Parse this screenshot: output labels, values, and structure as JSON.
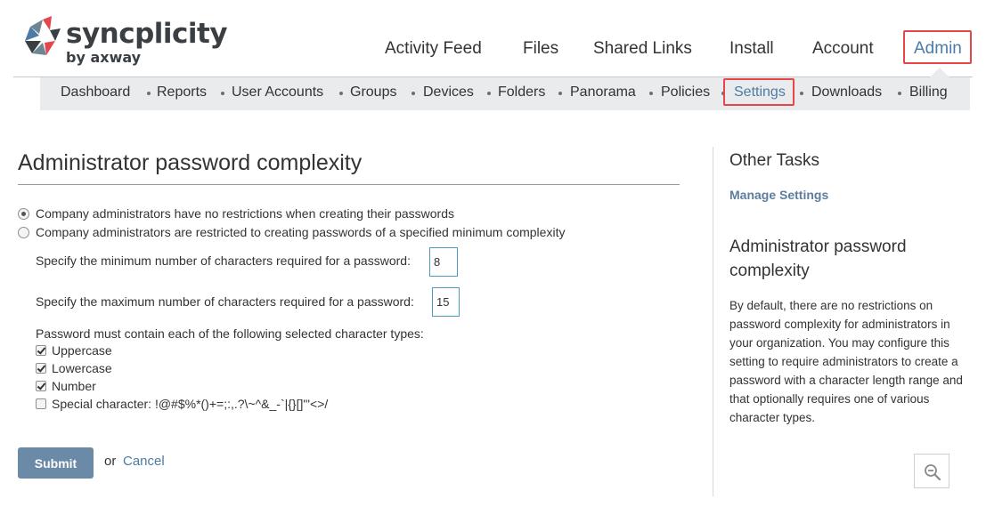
{
  "brand": {
    "name": "syncplicity",
    "sub": "by axway",
    "colors": [
      "#e4464a",
      "#4c7ba6",
      "#6e8596",
      "#3a3f44"
    ]
  },
  "main_nav": {
    "items": [
      {
        "label": "Activity Feed"
      },
      {
        "label": "Files"
      },
      {
        "label": "Shared Links"
      },
      {
        "label": "Install"
      },
      {
        "label": "Account"
      },
      {
        "label": "Admin",
        "active": true
      }
    ]
  },
  "sub_nav": {
    "items": [
      {
        "label": "Dashboard"
      },
      {
        "label": "Reports"
      },
      {
        "label": "User Accounts"
      },
      {
        "label": "Groups"
      },
      {
        "label": "Devices"
      },
      {
        "label": "Folders"
      },
      {
        "label": "Panorama"
      },
      {
        "label": "Policies"
      },
      {
        "label": "Settings",
        "active": true
      },
      {
        "label": "Downloads"
      },
      {
        "label": "Billing"
      }
    ]
  },
  "main": {
    "title": "Administrator password complexity",
    "options": [
      {
        "label": "Company administrators have no restrictions when creating their passwords",
        "checked": true
      },
      {
        "label": "Company administrators are restricted to creating passwords of a specified minimum complexity",
        "checked": false
      }
    ],
    "min_label": "Specify the minimum number of characters required for a password:",
    "min_value": "8",
    "max_label": "Specify the maximum number of characters required for a password:",
    "max_value": "15",
    "types_label": "Password must contain each of the following selected character types:",
    "types": [
      {
        "label": "Uppercase",
        "checked": true
      },
      {
        "label": "Lowercase",
        "checked": true
      },
      {
        "label": "Number",
        "checked": true
      },
      {
        "label": "Special character: !@#$%*()+=;:,.?\\~^&_-`|{}[]\"'<>/",
        "checked": false
      }
    ],
    "submit_label": "Submit",
    "or_text": "or",
    "cancel_label": "Cancel"
  },
  "sidebar": {
    "heading": "Other Tasks",
    "link": "Manage Settings",
    "title": "Administrator password complexity",
    "description": "By default, there are no restrictions on password complexity for administrators in your organization. You may configure this setting to require administrators to create a password with a character length range and that optionally requires one of various character types.",
    "zoom_icon": "zoom-out-icon"
  },
  "highlight_color": "#e4464a"
}
